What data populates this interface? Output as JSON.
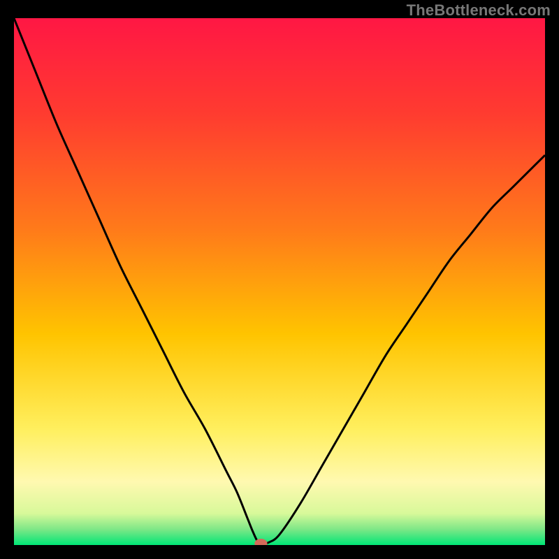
{
  "watermark": "TheBottleneck.com",
  "chart_data": {
    "type": "line",
    "title": "",
    "xlabel": "",
    "ylabel": "",
    "xlim": [
      0,
      100
    ],
    "ylim": [
      0,
      100
    ],
    "grid": false,
    "legend": false,
    "background_gradient": {
      "stops": [
        {
          "offset": 0.0,
          "color": "#ff1744"
        },
        {
          "offset": 0.18,
          "color": "#ff3b30"
        },
        {
          "offset": 0.4,
          "color": "#ff7a1a"
        },
        {
          "offset": 0.6,
          "color": "#ffc400"
        },
        {
          "offset": 0.78,
          "color": "#ffef5e"
        },
        {
          "offset": 0.88,
          "color": "#fff9b0"
        },
        {
          "offset": 0.94,
          "color": "#d8f99a"
        },
        {
          "offset": 0.97,
          "color": "#7ee787"
        },
        {
          "offset": 1.0,
          "color": "#00e676"
        }
      ]
    },
    "series": [
      {
        "name": "bottleneck-curve",
        "color": "#000000",
        "x": [
          0,
          4,
          8,
          12,
          16,
          20,
          24,
          28,
          32,
          36,
          40,
          42,
          44,
          45,
          46,
          47,
          48,
          50,
          54,
          58,
          62,
          66,
          70,
          74,
          78,
          82,
          86,
          90,
          94,
          98,
          100
        ],
        "y": [
          100,
          90,
          80,
          71,
          62,
          53,
          45,
          37,
          29,
          22,
          14,
          10,
          5,
          2.5,
          0.5,
          0.3,
          0.5,
          2,
          8,
          15,
          22,
          29,
          36,
          42,
          48,
          54,
          59,
          64,
          68,
          72,
          74
        ]
      }
    ],
    "marker": {
      "name": "optimal-point",
      "x": 46.5,
      "y": 0.3,
      "color": "#d46a5a",
      "rx": 1.2,
      "ry": 0.9
    }
  }
}
